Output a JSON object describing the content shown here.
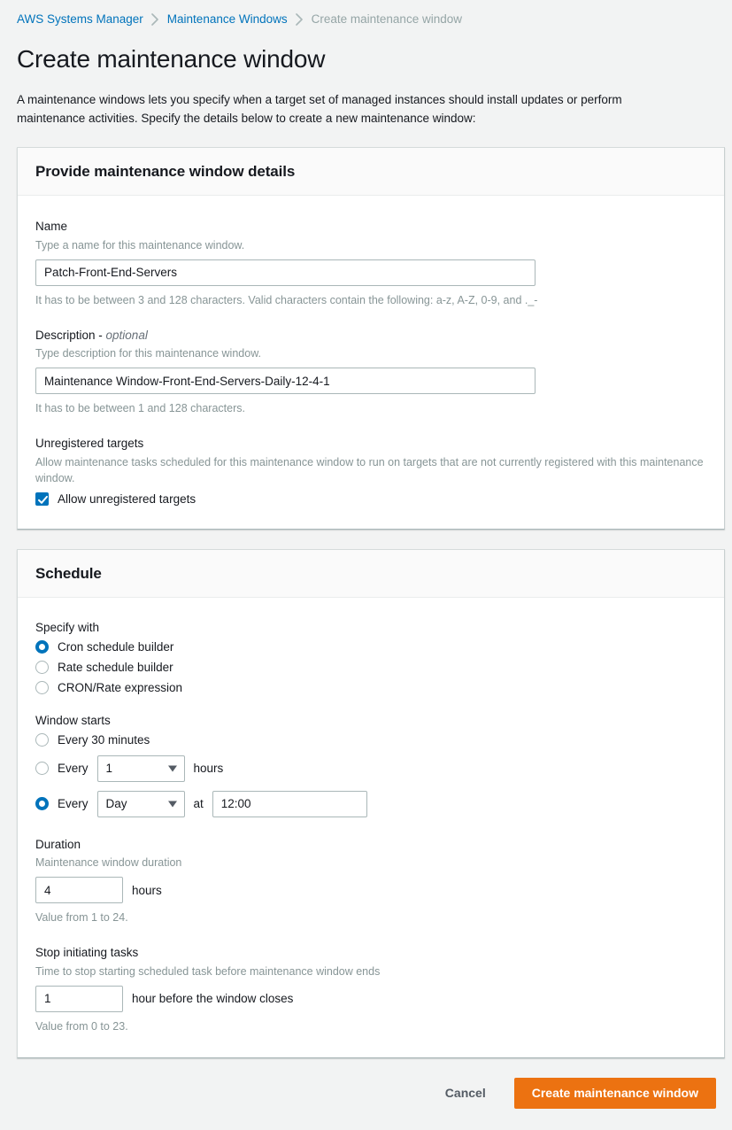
{
  "breadcrumb": {
    "items": [
      {
        "label": "AWS Systems Manager",
        "type": "link"
      },
      {
        "label": "Maintenance Windows",
        "type": "link"
      },
      {
        "label": "Create maintenance window",
        "type": "current"
      }
    ],
    "separator_icon": "chevron-right-icon"
  },
  "page": {
    "title": "Create maintenance window",
    "description": "A maintenance windows lets you specify when a target set of managed instances should install updates or perform maintenance activities. Specify the details below to create a new maintenance window:"
  },
  "details_panel": {
    "heading": "Provide maintenance window details",
    "name": {
      "label": "Name",
      "hint": "Type a name for this maintenance window.",
      "value": "Patch-Front-End-Servers",
      "placeholder": "",
      "note": "It has to be between 3 and 128 characters. Valid characters contain the following: a-z, A-Z, 0-9, and ._-"
    },
    "description": {
      "label": "Description - ",
      "label_optional": "optional",
      "hint": "Type description for this maintenance window.",
      "value": "Maintenance Window-Front-End-Servers-Daily-12-4-1",
      "placeholder": "",
      "note": "It has to be between 1 and 128 characters."
    },
    "unregistered_targets": {
      "label": "Unregistered targets",
      "hint": "Allow maintenance tasks scheduled for this maintenance window to run on targets that are not currently registered with this maintenance window.",
      "checkbox_label": "Allow unregistered targets",
      "checked": true
    }
  },
  "schedule_panel": {
    "heading": "Schedule",
    "specify_with": {
      "label": "Specify with",
      "options": [
        {
          "label": "Cron schedule builder",
          "selected": true
        },
        {
          "label": "Rate schedule builder",
          "selected": false
        },
        {
          "label": "CRON/Rate expression",
          "selected": false
        }
      ]
    },
    "window_starts": {
      "label": "Window starts",
      "option_30min": {
        "label": "Every 30 minutes",
        "selected": false
      },
      "option_hours": {
        "prefix": "Every",
        "selected": false,
        "select_value": "1",
        "suffix": "hours"
      },
      "option_day": {
        "prefix": "Every",
        "selected": true,
        "select_value": "Day",
        "mid": "at",
        "time_value": "12:00",
        "time_placeholder": ""
      }
    },
    "duration": {
      "label": "Duration",
      "hint": "Maintenance window duration",
      "value": "4",
      "unit": "hours",
      "note": "Value from 1 to 24."
    },
    "stop_initiating": {
      "label": "Stop initiating tasks",
      "hint": "Time to stop starting scheduled task before maintenance window ends",
      "value": "1",
      "unit": "hour before the window closes",
      "note": "Value from 0 to 23."
    }
  },
  "footer": {
    "cancel_label": "Cancel",
    "submit_label": "Create maintenance window"
  },
  "colors": {
    "link": "#0073bb",
    "accent": "#0073bb",
    "primary_button": "#ec7211",
    "page_background": "#f2f3f3",
    "muted_text": "#879596"
  }
}
